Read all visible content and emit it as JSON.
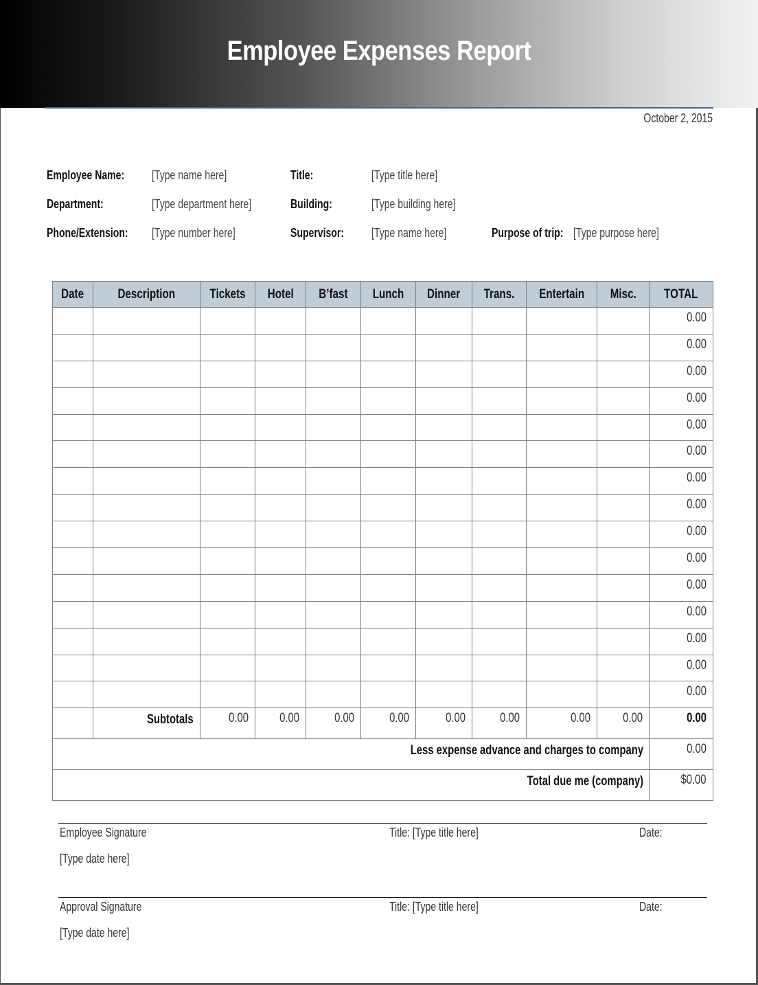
{
  "header": {
    "title": "Employee Expenses Report",
    "date": "October 2, 2015"
  },
  "info": {
    "employee_name": {
      "label": "Employee Name:",
      "value": "[Type name here]"
    },
    "title": {
      "label": "Title:",
      "value": "[Type title here]"
    },
    "department": {
      "label": "Department:",
      "value": "[Type department here]"
    },
    "building": {
      "label": "Building:",
      "value": "[Type building here]"
    },
    "phone": {
      "label": "Phone/Extension:",
      "value": "[Type number here]"
    },
    "supervisor": {
      "label": "Supervisor:",
      "value": "[Type name here]"
    },
    "purpose": {
      "label": "Purpose of trip:",
      "value": "[Type purpose here]"
    }
  },
  "table": {
    "columns": [
      "Date",
      "Description",
      "Tickets",
      "Hotel",
      "B’fast",
      "Lunch",
      "Dinner",
      "Trans.",
      "Entertain",
      "Misc.",
      "TOTAL"
    ],
    "rows": [
      {
        "total": "0.00"
      },
      {
        "total": "0.00"
      },
      {
        "total": "0.00"
      },
      {
        "total": "0.00"
      },
      {
        "total": "0.00"
      },
      {
        "total": "0.00"
      },
      {
        "total": "0.00"
      },
      {
        "total": "0.00"
      },
      {
        "total": "0.00"
      },
      {
        "total": "0.00"
      },
      {
        "total": "0.00"
      },
      {
        "total": "0.00"
      },
      {
        "total": "0.00"
      },
      {
        "total": "0.00"
      },
      {
        "total": "0.00"
      }
    ],
    "subtotals": {
      "label": "Subtotals",
      "tickets": "0.00",
      "hotel": "0.00",
      "bfast": "0.00",
      "lunch": "0.00",
      "dinner": "0.00",
      "trans": "0.00",
      "entertain": "0.00",
      "misc": "0.00",
      "total": "0.00"
    },
    "advance": {
      "label": "Less expense advance and charges to company",
      "value": "0.00"
    },
    "total_due": {
      "label": "Total due me (company)",
      "value": "$0.00"
    }
  },
  "signatures": [
    {
      "label": "Employee Signature",
      "title": "Title: [Type title here]",
      "date_label": "Date:",
      "date_value": "[Type date here]"
    },
    {
      "label": "Approval Signature",
      "title": "Title: [Type title here]",
      "date_label": "Date:",
      "date_value": "[Type date here]"
    }
  ]
}
